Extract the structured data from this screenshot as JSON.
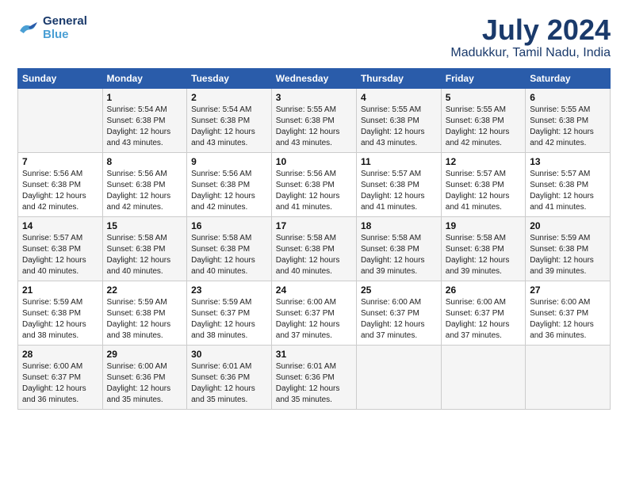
{
  "header": {
    "logo_line1": "General",
    "logo_line2": "Blue",
    "month": "July 2024",
    "location": "Madukkur, Tamil Nadu, India"
  },
  "weekdays": [
    "Sunday",
    "Monday",
    "Tuesday",
    "Wednesday",
    "Thursday",
    "Friday",
    "Saturday"
  ],
  "weeks": [
    [
      {
        "day": "",
        "info": ""
      },
      {
        "day": "1",
        "info": "Sunrise: 5:54 AM\nSunset: 6:38 PM\nDaylight: 12 hours\nand 43 minutes."
      },
      {
        "day": "2",
        "info": "Sunrise: 5:54 AM\nSunset: 6:38 PM\nDaylight: 12 hours\nand 43 minutes."
      },
      {
        "day": "3",
        "info": "Sunrise: 5:55 AM\nSunset: 6:38 PM\nDaylight: 12 hours\nand 43 minutes."
      },
      {
        "day": "4",
        "info": "Sunrise: 5:55 AM\nSunset: 6:38 PM\nDaylight: 12 hours\nand 43 minutes."
      },
      {
        "day": "5",
        "info": "Sunrise: 5:55 AM\nSunset: 6:38 PM\nDaylight: 12 hours\nand 42 minutes."
      },
      {
        "day": "6",
        "info": "Sunrise: 5:55 AM\nSunset: 6:38 PM\nDaylight: 12 hours\nand 42 minutes."
      }
    ],
    [
      {
        "day": "7",
        "info": "Sunrise: 5:56 AM\nSunset: 6:38 PM\nDaylight: 12 hours\nand 42 minutes."
      },
      {
        "day": "8",
        "info": "Sunrise: 5:56 AM\nSunset: 6:38 PM\nDaylight: 12 hours\nand 42 minutes."
      },
      {
        "day": "9",
        "info": "Sunrise: 5:56 AM\nSunset: 6:38 PM\nDaylight: 12 hours\nand 42 minutes."
      },
      {
        "day": "10",
        "info": "Sunrise: 5:56 AM\nSunset: 6:38 PM\nDaylight: 12 hours\nand 41 minutes."
      },
      {
        "day": "11",
        "info": "Sunrise: 5:57 AM\nSunset: 6:38 PM\nDaylight: 12 hours\nand 41 minutes."
      },
      {
        "day": "12",
        "info": "Sunrise: 5:57 AM\nSunset: 6:38 PM\nDaylight: 12 hours\nand 41 minutes."
      },
      {
        "day": "13",
        "info": "Sunrise: 5:57 AM\nSunset: 6:38 PM\nDaylight: 12 hours\nand 41 minutes."
      }
    ],
    [
      {
        "day": "14",
        "info": "Sunrise: 5:57 AM\nSunset: 6:38 PM\nDaylight: 12 hours\nand 40 minutes."
      },
      {
        "day": "15",
        "info": "Sunrise: 5:58 AM\nSunset: 6:38 PM\nDaylight: 12 hours\nand 40 minutes."
      },
      {
        "day": "16",
        "info": "Sunrise: 5:58 AM\nSunset: 6:38 PM\nDaylight: 12 hours\nand 40 minutes."
      },
      {
        "day": "17",
        "info": "Sunrise: 5:58 AM\nSunset: 6:38 PM\nDaylight: 12 hours\nand 40 minutes."
      },
      {
        "day": "18",
        "info": "Sunrise: 5:58 AM\nSunset: 6:38 PM\nDaylight: 12 hours\nand 39 minutes."
      },
      {
        "day": "19",
        "info": "Sunrise: 5:58 AM\nSunset: 6:38 PM\nDaylight: 12 hours\nand 39 minutes."
      },
      {
        "day": "20",
        "info": "Sunrise: 5:59 AM\nSunset: 6:38 PM\nDaylight: 12 hours\nand 39 minutes."
      }
    ],
    [
      {
        "day": "21",
        "info": "Sunrise: 5:59 AM\nSunset: 6:38 PM\nDaylight: 12 hours\nand 38 minutes."
      },
      {
        "day": "22",
        "info": "Sunrise: 5:59 AM\nSunset: 6:38 PM\nDaylight: 12 hours\nand 38 minutes."
      },
      {
        "day": "23",
        "info": "Sunrise: 5:59 AM\nSunset: 6:37 PM\nDaylight: 12 hours\nand 38 minutes."
      },
      {
        "day": "24",
        "info": "Sunrise: 6:00 AM\nSunset: 6:37 PM\nDaylight: 12 hours\nand 37 minutes."
      },
      {
        "day": "25",
        "info": "Sunrise: 6:00 AM\nSunset: 6:37 PM\nDaylight: 12 hours\nand 37 minutes."
      },
      {
        "day": "26",
        "info": "Sunrise: 6:00 AM\nSunset: 6:37 PM\nDaylight: 12 hours\nand 37 minutes."
      },
      {
        "day": "27",
        "info": "Sunrise: 6:00 AM\nSunset: 6:37 PM\nDaylight: 12 hours\nand 36 minutes."
      }
    ],
    [
      {
        "day": "28",
        "info": "Sunrise: 6:00 AM\nSunset: 6:37 PM\nDaylight: 12 hours\nand 36 minutes."
      },
      {
        "day": "29",
        "info": "Sunrise: 6:00 AM\nSunset: 6:36 PM\nDaylight: 12 hours\nand 35 minutes."
      },
      {
        "day": "30",
        "info": "Sunrise: 6:01 AM\nSunset: 6:36 PM\nDaylight: 12 hours\nand 35 minutes."
      },
      {
        "day": "31",
        "info": "Sunrise: 6:01 AM\nSunset: 6:36 PM\nDaylight: 12 hours\nand 35 minutes."
      },
      {
        "day": "",
        "info": ""
      },
      {
        "day": "",
        "info": ""
      },
      {
        "day": "",
        "info": ""
      }
    ]
  ]
}
